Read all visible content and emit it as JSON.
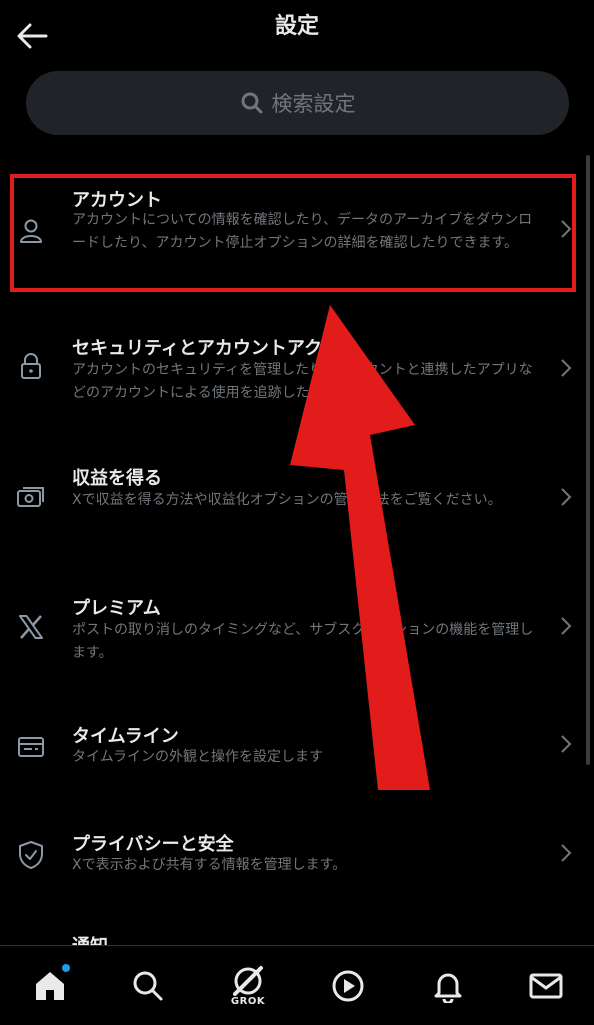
{
  "header": {
    "title": "設定",
    "search_placeholder": "検索設定"
  },
  "items": [
    {
      "title": "アカウント",
      "desc": "アカウントについての情報を確認したり、データのアーカイブをダウンロードしたり、アカウント停止オプションの詳細を確認したりできます。",
      "icon": "person-icon"
    },
    {
      "title": "セキュリティとアカウントアクセス",
      "desc": "アカウントのセキュリティを管理したり、アカウントと連携したアプリなどのアカウントによる使用を追跡したりします。",
      "icon": "lock-icon"
    },
    {
      "title": "収益を得る",
      "desc": "Xで収益を得る方法や収益化オプションの管理方法をご覧ください。",
      "icon": "money-icon"
    },
    {
      "title": "プレミアム",
      "desc": "ポストの取り消しのタイミングなど、サブスクリプションの機能を管理します。",
      "icon": "x-logo-icon"
    },
    {
      "title": "タイムライン",
      "desc": "タイムラインの外観と操作を設定します",
      "icon": "timeline-icon"
    },
    {
      "title": "プライバシーと安全",
      "desc": "Xで表示および共有する情報を管理します。",
      "icon": "shield-icon"
    },
    {
      "title": "通知",
      "desc": "",
      "icon": "bell-icon"
    }
  ],
  "nav": {
    "grok_label": "GROK"
  },
  "colors": {
    "highlight": "#e21b1b",
    "accent": "#1d9bf0",
    "background": "#000000"
  }
}
